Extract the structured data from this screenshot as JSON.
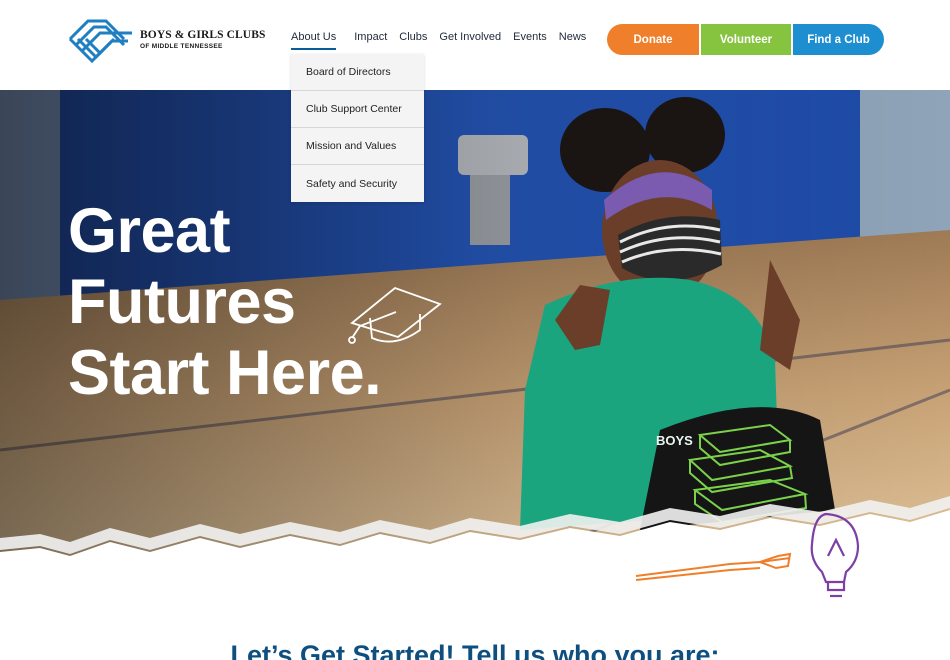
{
  "header": {
    "logo": {
      "line1": "BOYS & GIRLS CLUBS",
      "line2": "OF MIDDLE TENNESSEE"
    },
    "nav": [
      {
        "label": "About Us",
        "active": true
      },
      {
        "label": "Impact"
      },
      {
        "label": "Clubs"
      },
      {
        "label": "Get Involved"
      },
      {
        "label": "Events"
      },
      {
        "label": "News"
      }
    ],
    "cta": {
      "donate": "Donate",
      "volunteer": "Volunteer",
      "find_club": "Find a Club"
    }
  },
  "dropdown": {
    "items": [
      "Board of Directors",
      "Club Support Center",
      "Mission and Values",
      "Safety and Security"
    ]
  },
  "hero": {
    "title_lines": [
      "Great",
      "Futures",
      "Start Here."
    ],
    "shirt_text": "BOYS"
  },
  "section": {
    "heading": "Let’s Get Started! Tell us who you are:"
  },
  "colors": {
    "brand_blue": "#0a5c9a",
    "donate": "#ef7f2a",
    "volunteer": "#86c33f",
    "find_club": "#1d8fd0",
    "heading": "#0e4f80"
  }
}
